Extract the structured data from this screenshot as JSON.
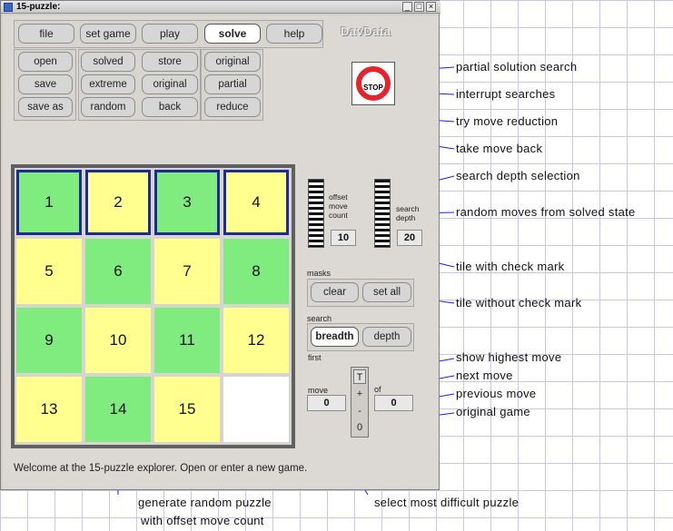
{
  "window": {
    "title": "15-puzzle:",
    "controls": [
      "_",
      "□",
      "×"
    ]
  },
  "brand": "DavData",
  "menu": [
    "file",
    "set game",
    "play",
    "solve",
    "help"
  ],
  "menu_active": "solve",
  "actions": {
    "col1": [
      "open",
      "save",
      "save as"
    ],
    "col2": [
      "solved",
      "extreme",
      "random"
    ],
    "col3": [
      "store",
      "original",
      "back"
    ],
    "col4": [
      "original",
      "partial",
      "reduce"
    ]
  },
  "stop_label": "STOP",
  "tiles": [
    {
      "label": "1",
      "color": "green",
      "checked": true
    },
    {
      "label": "2",
      "color": "yellow",
      "checked": true
    },
    {
      "label": "3",
      "color": "green",
      "checked": true
    },
    {
      "label": "4",
      "color": "yellow",
      "checked": true
    },
    {
      "label": "5",
      "color": "yellow",
      "checked": false
    },
    {
      "label": "6",
      "color": "green",
      "checked": false
    },
    {
      "label": "7",
      "color": "yellow",
      "checked": false
    },
    {
      "label": "8",
      "color": "green",
      "checked": false
    },
    {
      "label": "9",
      "color": "green",
      "checked": false
    },
    {
      "label": "10",
      "color": "yellow",
      "checked": false
    },
    {
      "label": "11",
      "color": "green",
      "checked": false
    },
    {
      "label": "12",
      "color": "yellow",
      "checked": false
    },
    {
      "label": "13",
      "color": "yellow",
      "checked": false
    },
    {
      "label": "14",
      "color": "green",
      "checked": false
    },
    {
      "label": "15",
      "color": "yellow",
      "checked": false
    },
    {
      "label": "",
      "color": "white",
      "checked": false
    }
  ],
  "offset": {
    "label_lines": [
      "offset",
      "move",
      "count"
    ],
    "value": "10"
  },
  "search_depth": {
    "label_lines": [
      "search",
      "depth"
    ],
    "value": "20"
  },
  "masks": {
    "label": "masks",
    "clear": "clear",
    "set_all": "set all"
  },
  "search": {
    "label": "search",
    "breadth": "breadth",
    "depth": "depth",
    "first": "first"
  },
  "move": {
    "label": "move",
    "value": "0",
    "of_label": "of",
    "of_value": "0",
    "buttons": [
      "T",
      "+",
      "-",
      "0"
    ]
  },
  "status": "Welcome at the 15-puzzle explorer. Open or enter a new game.",
  "annotations": {
    "partial": "partial solution search",
    "interrupt": "interrupt searches",
    "reduce": "try move reduction",
    "back": "take move back",
    "depth": "search depth selection",
    "random_moves": "random moves from solved state",
    "check": "tile with check mark",
    "nocheck": "tile without check mark",
    "highest": "show highest move",
    "next": "next move",
    "previous": "previous move",
    "original": "original game",
    "random_1": "generate random puzzle",
    "random_2": "with offset move count",
    "extreme": "select most difficult puzzle"
  },
  "colors": {
    "tile_green": "#80ec80",
    "tile_yellow": "#ffff90",
    "check_border": "#1f2a9a",
    "annotation_line": "#1a1aff",
    "stop_red": "#e8222a"
  }
}
